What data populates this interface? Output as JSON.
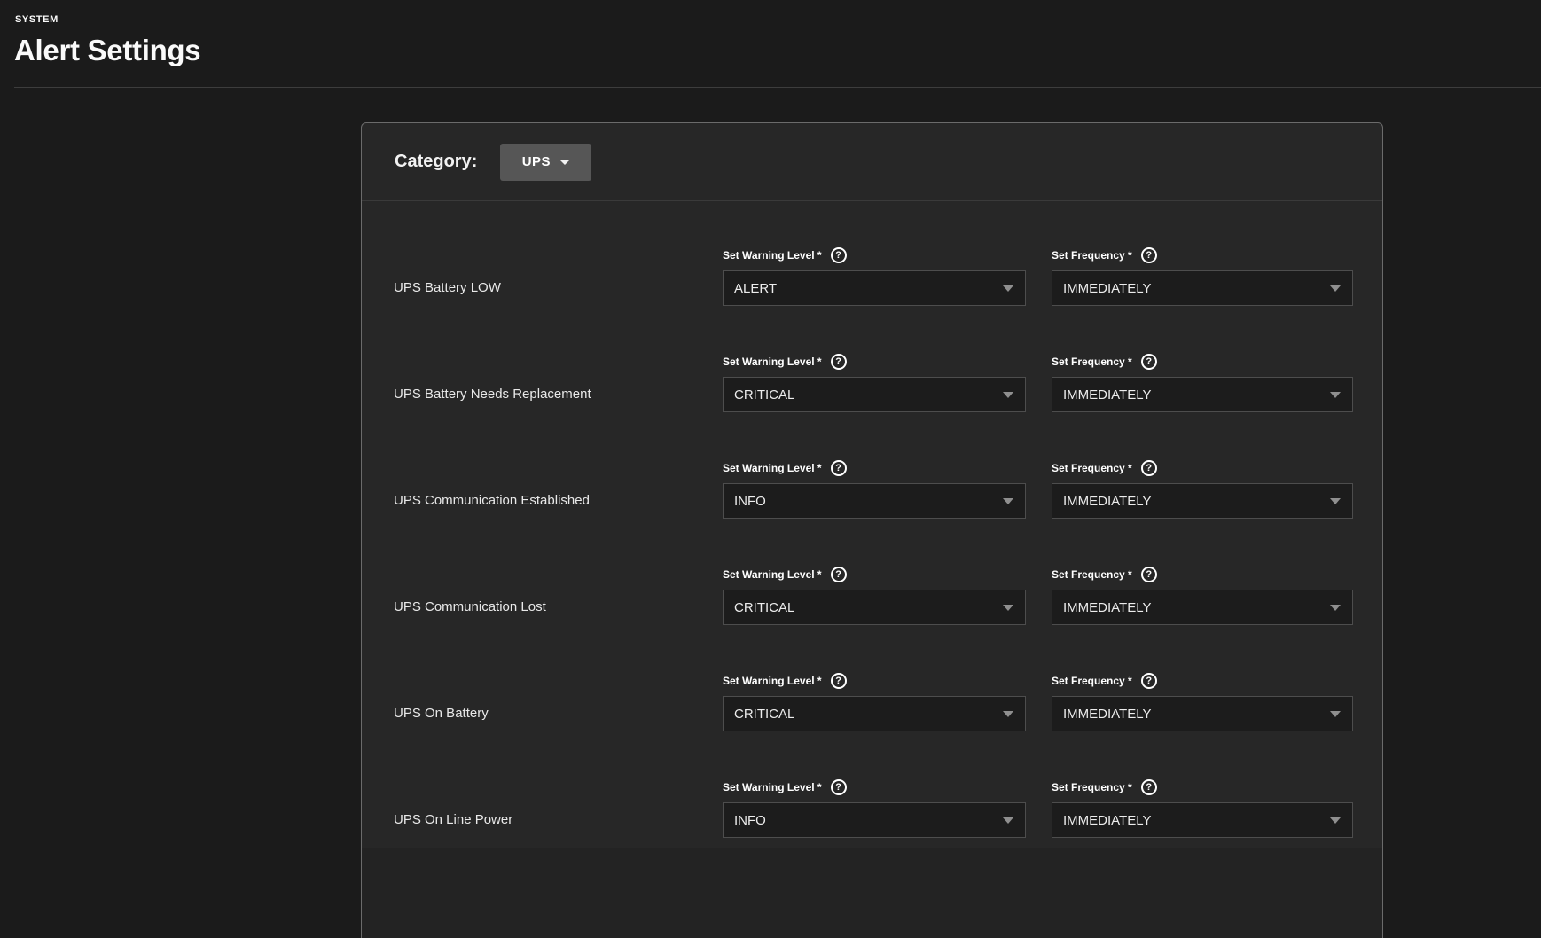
{
  "page": {
    "kicker": "SYSTEM",
    "title": "Alert Settings"
  },
  "category": {
    "label": "Category:",
    "value": "UPS"
  },
  "field_labels": {
    "warning": "Set Warning Level *",
    "frequency": "Set Frequency *"
  },
  "icons": {
    "help": "?",
    "dropdown_arrow": "caret-down"
  },
  "rows": [
    {
      "name": "UPS Battery LOW",
      "warning_level": "ALERT",
      "frequency": "IMMEDIATELY"
    },
    {
      "name": "UPS Battery Needs Replacement",
      "warning_level": "CRITICAL",
      "frequency": "IMMEDIATELY"
    },
    {
      "name": "UPS Communication Established",
      "warning_level": "INFO",
      "frequency": "IMMEDIATELY"
    },
    {
      "name": "UPS Communication Lost",
      "warning_level": "CRITICAL",
      "frequency": "IMMEDIATELY"
    },
    {
      "name": "UPS On Battery",
      "warning_level": "CRITICAL",
      "frequency": "IMMEDIATELY"
    },
    {
      "name": "UPS On Line Power",
      "warning_level": "INFO",
      "frequency": "IMMEDIATELY"
    }
  ],
  "colors": {
    "page_bg": "#1b1b1b",
    "panel_bg": "#272727",
    "panel_border": "#6b6b6b",
    "select_bg": "#1c1c1c",
    "select_border": "#4d4d4d",
    "button_bg": "#565656",
    "text": "#e9e9e9"
  }
}
